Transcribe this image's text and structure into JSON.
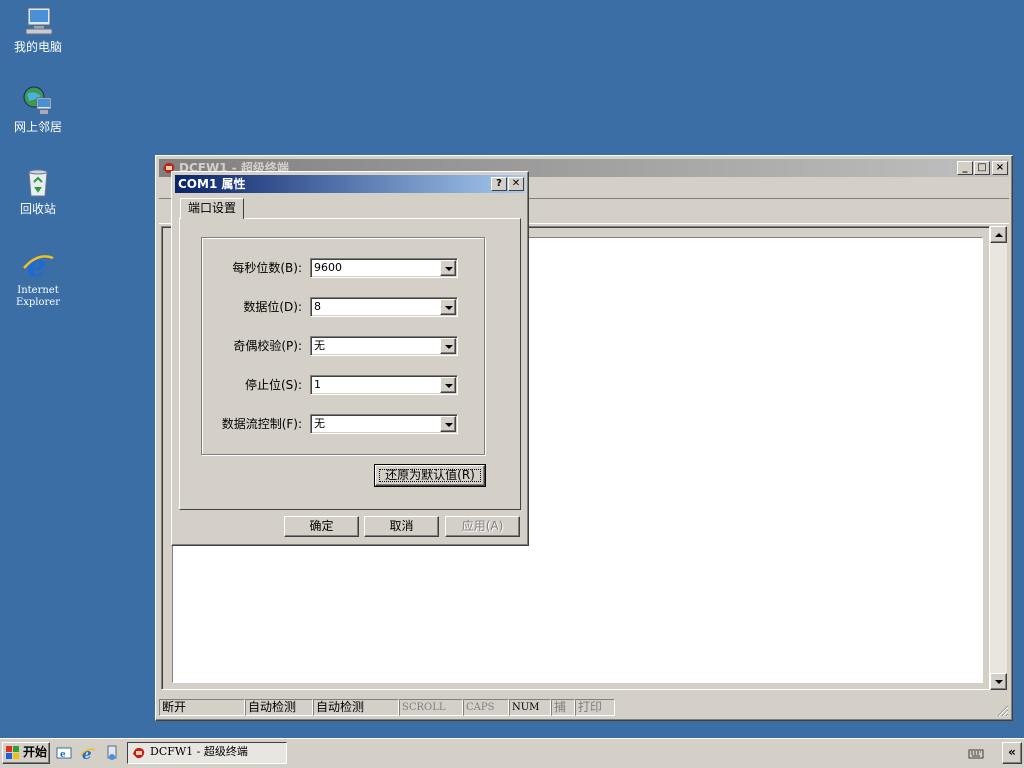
{
  "desktop": {
    "icons": [
      {
        "label": "我的电脑",
        "icon": "my-computer-icon"
      },
      {
        "label": "网上邻居",
        "icon": "network-places-icon"
      },
      {
        "label": "回收站",
        "icon": "recycle-bin-icon"
      },
      {
        "label_line1": "Internet",
        "label_line2": "Explorer",
        "icon": "internet-explorer-icon"
      }
    ]
  },
  "main_window": {
    "title": "DCFW1 - 超级终端"
  },
  "dialog": {
    "title": "COM1 属性",
    "help_glyph": "?",
    "close_glyph": "✕",
    "tab": "端口设置",
    "fields": [
      {
        "label": "每秒位数(B):",
        "value": "9600"
      },
      {
        "label": "数据位(D):",
        "value": "8"
      },
      {
        "label": "奇偶校验(P):",
        "value": "无"
      },
      {
        "label": "停止位(S):",
        "value": "1"
      },
      {
        "label": "数据流控制(F):",
        "value": "无"
      }
    ],
    "restore_button": "还原为默认值(R)",
    "ok_button": "确定",
    "cancel_button": "取消",
    "apply_button": "应用(A)"
  },
  "statusbar": {
    "cells": [
      "断开",
      "自动检测",
      "自动检测",
      "SCROLL",
      "CAPS",
      "NUM",
      "捕",
      "打印"
    ]
  },
  "taskbar": {
    "start": "开始",
    "task": "DCFW1 - 超级终端",
    "show_desktop_glyph": "«"
  },
  "colors": {
    "desktop": "#3a6ea5",
    "active_title_start": "#0a246a",
    "active_title_end": "#a6caf0",
    "face": "#d4d0c8"
  }
}
